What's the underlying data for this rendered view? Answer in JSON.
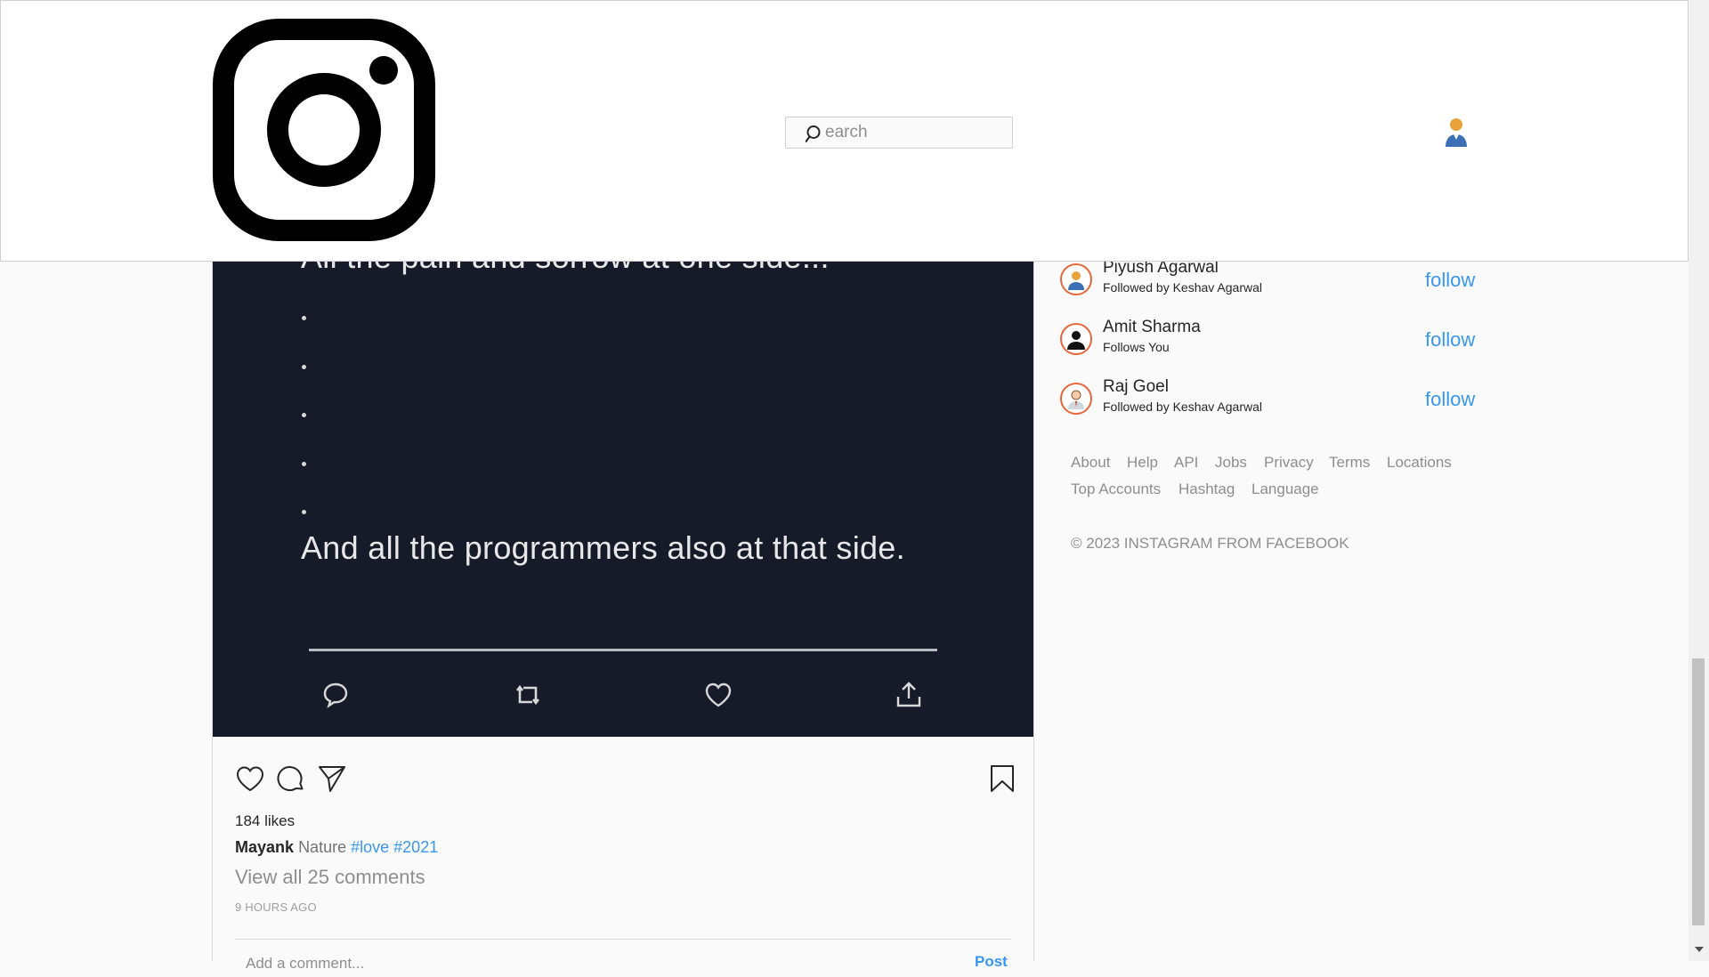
{
  "header": {
    "search_placeholder": "earch"
  },
  "post": {
    "image_text": {
      "cut_line": "All the pain and sorrow at one side...",
      "main_line": "And all the programmers also at that side."
    },
    "likes": "184 likes",
    "caption": {
      "username": "Mayank",
      "text": "Nature",
      "hashtags": [
        "#love",
        "#2021"
      ]
    },
    "comments_link": "View all 25 comments",
    "timestamp": "9 HOURS AGO",
    "comment_placeholder": "Add a comment...",
    "post_button": "Post"
  },
  "suggestions": [
    {
      "name": "Piyush Agarwal",
      "subtitle": "Followed by Keshav Agarwal",
      "action": "follow",
      "avatar": "user-colored"
    },
    {
      "name": "Amit Sharma",
      "subtitle": "Follows You",
      "action": "follow",
      "avatar": "user-black"
    },
    {
      "name": "Raj Goel",
      "subtitle": "Followed by Keshav Agarwal",
      "action": "follow",
      "avatar": "user-office"
    }
  ],
  "footer": {
    "links": [
      "About",
      "Help",
      "API",
      "Jobs",
      "Privacy",
      "Terms",
      "Locations",
      "Top Accounts",
      "Hashtag",
      "Language"
    ],
    "copyright": "© 2023 INSTAGRAM FROM FACEBOOK"
  },
  "colors": {
    "accent": "#3897f0",
    "story_ring": "#e8663a",
    "post_image_bg": "#171a28"
  }
}
